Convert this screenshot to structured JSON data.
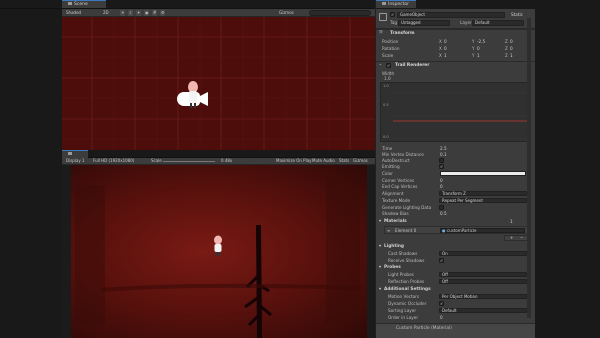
{
  "scene": {
    "tab_label": "Scene",
    "shading": "Shaded",
    "mode_2d": "2D",
    "gizmos": "Gizmos",
    "search_placeholder": "All"
  },
  "game": {
    "tab_label": "Game",
    "display": "Display 1",
    "resolution": "Full HD (1920x1080)",
    "scale_label": "Scale",
    "scale_value": "0.48x",
    "maximize": "Maximize On Play",
    "mute": "Mute Audio",
    "stats": "Stats",
    "gizmos": "Gizmos"
  },
  "inspector": {
    "tab_label": "Inspector",
    "object_name": "GameObject",
    "static_label": "Static",
    "tag_label": "Tag",
    "tag_value": "Untagged",
    "layer_label": "Layer",
    "layer_value": "Default",
    "transform": {
      "title": "Transform",
      "rows": [
        {
          "label": "Position",
          "x": "0",
          "y": "-2.5",
          "z": "0"
        },
        {
          "label": "Rotation",
          "x": "0",
          "y": "0",
          "z": "0"
        },
        {
          "label": "Scale",
          "x": "1",
          "y": "1",
          "z": "1"
        }
      ],
      "axis_x": "X",
      "axis_y": "Y",
      "axis_z": "Z"
    },
    "trail": {
      "title": "Trail Renderer",
      "width_label": "Width",
      "width_value": "1.0",
      "curve_ticks": [
        "1.0",
        "0.5",
        "0.0"
      ],
      "curve_color": "#c0392b",
      "props": [
        {
          "label": "Time",
          "value": "2.5"
        },
        {
          "label": "Min Vertex Distance",
          "value": "0.1"
        },
        {
          "label": "AutoDestruct",
          "check": ""
        },
        {
          "label": "Emitting",
          "check": "✓"
        },
        {
          "label": "Color",
          "swatch": "#ececec"
        },
        {
          "label": "Corner Vertices",
          "value": "0"
        },
        {
          "label": "End Cap Vertices",
          "value": "0"
        },
        {
          "label": "Alignment",
          "dropdown": "Transform Z"
        },
        {
          "label": "Texture Mode",
          "dropdown": "Repeat Per Segment"
        },
        {
          "label": "Generate Lighting Data",
          "check": ""
        },
        {
          "label": "Shadow Bias",
          "value": "0.5"
        }
      ],
      "materials_title": "Materials",
      "materials_count": "1",
      "element_label": "Element 0",
      "element_value": "customParticle",
      "lighting_title": "Lighting",
      "cast_shadows_label": "Cast Shadows",
      "cast_shadows_value": "On",
      "receive_shadows_label": "Receive Shadows",
      "receive_shadows_check": "✓",
      "probes_title": "Probes",
      "light_probes_label": "Light Probes",
      "light_probes_value": "Off",
      "reflection_probes_label": "Reflection Probes",
      "reflection_probes_value": "Off",
      "additional_title": "Additional Settings",
      "motion_vectors_label": "Motion Vectors",
      "motion_vectors_value": "Per Object Motion",
      "dynamic_occluder_label": "Dynamic Occluder",
      "dynamic_occluder_check": "✓",
      "sorting_layer_label": "Sorting Layer",
      "sorting_layer_value": "Default",
      "order_label": "Order in Layer",
      "order_value": "0"
    },
    "material_footer": "Custom Particle (Material)"
  }
}
